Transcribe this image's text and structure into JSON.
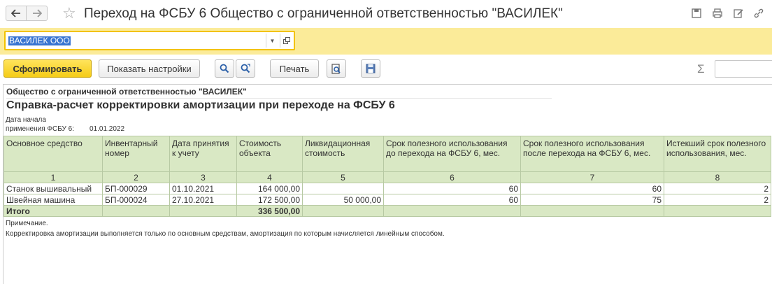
{
  "window": {
    "title": "Переход на ФСБУ 6 Общество с ограниченной ответственностью \"ВАСИЛЕК\""
  },
  "params": {
    "organization": "ВАСИЛЕК ООО"
  },
  "toolbar": {
    "generate_label": "Сформировать",
    "settings_label": "Показать настройки",
    "print_label": "Печать",
    "sum_symbol": "Σ"
  },
  "report": {
    "organization": "Общество с ограниченной ответственностью \"ВАСИЛЕК\"",
    "title": "Справка-расчет корректировки амортизации при переходе на ФСБУ 6",
    "date_label_line1": "Дата начала",
    "date_label_line2": "применения ФСБУ 6:",
    "date_value": "01.01.2022",
    "headers": [
      "Основное средство",
      "Инвентарный номер",
      "Дата принятия к учету",
      "Стоимость объекта",
      "Ликвидационная стоимость",
      "Срок полезного использования до перехода на ФСБУ 6, мес.",
      "Срок полезного использования после перехода на ФСБУ 6, мес.",
      "Истекший срок полезного использования, мес."
    ],
    "column_numbers": [
      "1",
      "2",
      "3",
      "4",
      "5",
      "6",
      "7",
      "8"
    ],
    "rows": [
      [
        "Станок вышивальный",
        "БП-000029",
        "01.10.2021",
        "164 000,00",
        "",
        "60",
        "60",
        "2"
      ],
      [
        "Швейная машина",
        "БП-000024",
        "27.10.2021",
        "172 500,00",
        "50 000,00",
        "60",
        "75",
        "2"
      ]
    ],
    "total_label": "Итого",
    "total_value": "336 500,00",
    "note_label": "Примечание.",
    "note_text": "Корректировка амортизации выполняется только по основным средствам, амортизация по которым начисляется линейным способом."
  }
}
